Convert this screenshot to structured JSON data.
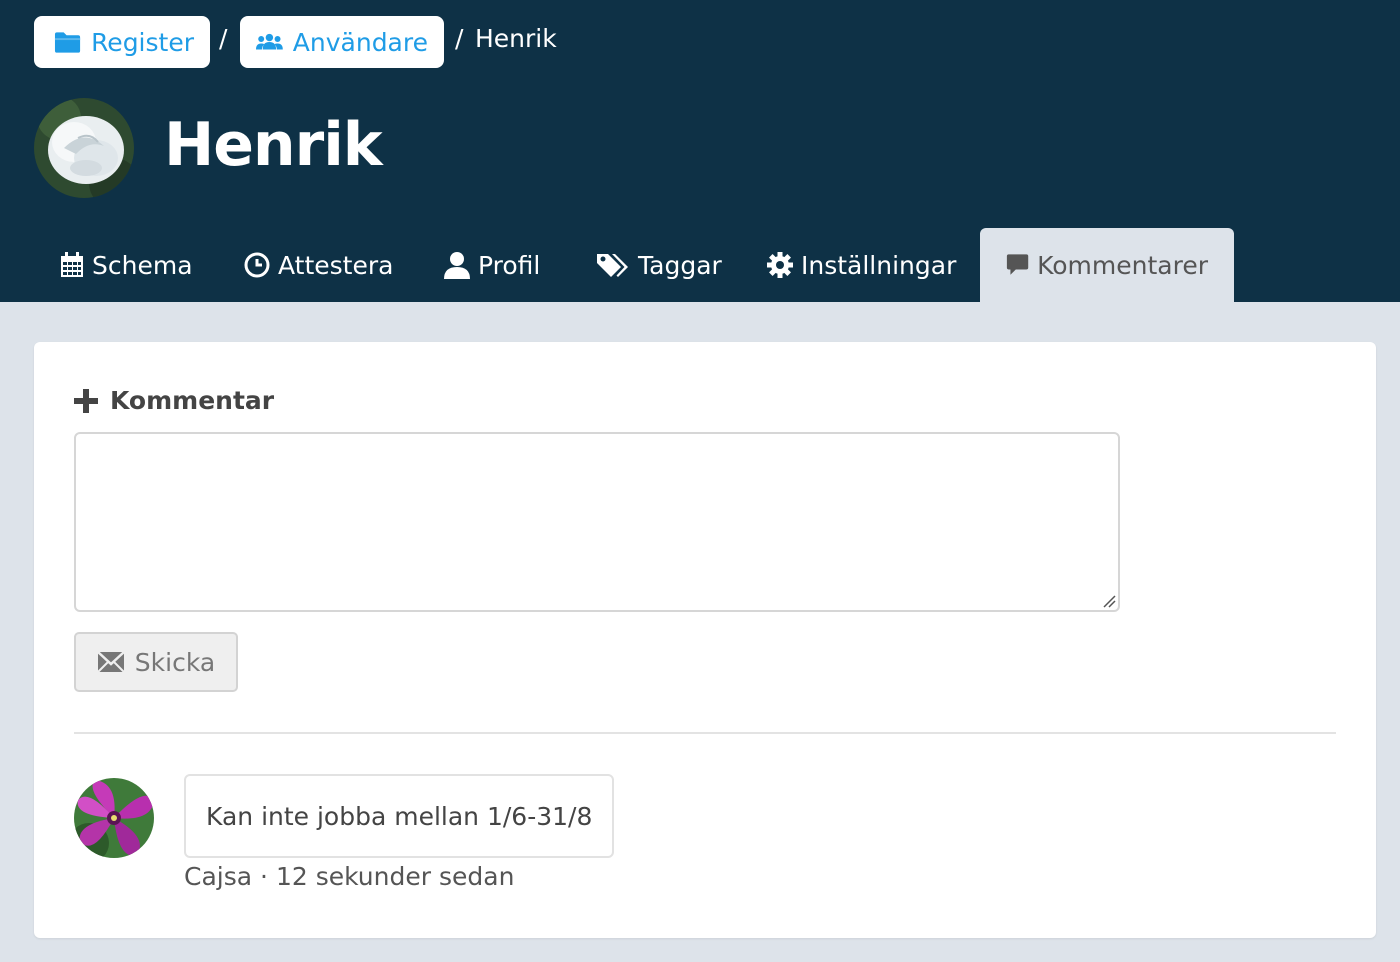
{
  "breadcrumb": {
    "register_label": "Register",
    "users_label": "Användare",
    "separator": "/",
    "current": "Henrik"
  },
  "user": {
    "name": "Henrik"
  },
  "tabs": [
    {
      "label": "Schema",
      "icon": "calendar-icon"
    },
    {
      "label": "Attestera",
      "icon": "clock-icon"
    },
    {
      "label": "Profil",
      "icon": "user-icon"
    },
    {
      "label": "Taggar",
      "icon": "tags-icon"
    },
    {
      "label": "Inställningar",
      "icon": "gear-icon"
    },
    {
      "label": "Kommentarer",
      "icon": "comment-icon",
      "active": true
    }
  ],
  "comment_form": {
    "title": "Kommentar",
    "textarea_value": "",
    "send_label": "Skicka"
  },
  "comments": [
    {
      "text": "Kan inte jobba mellan 1/6-31/8",
      "author": "Cajsa",
      "separator": "·",
      "time": "12 sekunder sedan"
    }
  ],
  "colors": {
    "header_bg": "#0e3146",
    "page_bg": "#dde3ea",
    "link_blue": "#1f9ce6"
  }
}
